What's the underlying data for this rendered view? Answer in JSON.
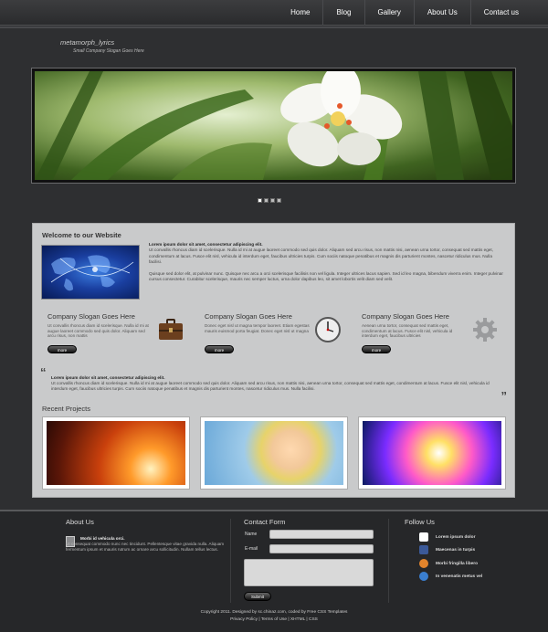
{
  "nav": {
    "items": [
      "Home",
      "Blog",
      "Gallery",
      "About Us",
      "Contact us"
    ]
  },
  "header": {
    "site_title": "metamorph_lyrics",
    "slogan": "Small Company Slogan Goes Here"
  },
  "welcome": {
    "title": "Welcome to our Website",
    "lead": "Lorem ipsum dolor sit amet, consectetur adipiscing elit.",
    "para1": "Ut convallis rhoncus diam id scelerisque. Nulla id mi at augue laoreet commodo sed quis dolor. Aliquam sed arcu risus, non mattis nisi, aenean urna tortor, consequat sed mattis eget, condimentum at lacus. Fusce elit nisl, vehicula id interdum eget, faucibus ultricies turpis. Cum sociis natoque penatibus et magnis dis parturient montes, nascetur ridiculus mus. Nulla facilisi.",
    "para2": "Quisque sed dolor elit, at pulvinar nunc. Quisque nec arcu a orci scelerisque facilisis non vel ligula. Integer ultrices lacus sapien. Sed id leo magna, bibendum viverra enim. Integer pulvinar cursus consectetur. Curabitur scelerisque, mauris nec semper luctus, urna dolor dapibus leo, sit amet lobortis velit diam sed velit."
  },
  "columns": [
    {
      "title": "Company Slogan Goes Here",
      "text": "Ut convallis rhoncus diam id scelerisque. Nulla id mi at augue laoreet commodo sed quis dolor. Aliquam sed arcu risus, non mattis",
      "more": "more",
      "icon": "briefcase-icon"
    },
    {
      "title": "Company Slogan Goes Here",
      "text": "Donec eget nisl ut magna tempor laoreet. Etiam egestas mauris euismod porta feugiat. Donec eget nisl ut magna",
      "more": "more",
      "icon": "clock-icon"
    },
    {
      "title": "Company Slogan Goes Here",
      "text": "Aenean urna tortor, consequat sed mattis eget, condimentum at lacus. Fusce elit nisl, vehicula id interdum eget, faucibus ultricies",
      "more": "more",
      "icon": "gear-icon"
    }
  ],
  "quote": {
    "lead": "Lorem ipsum dolor sit amet, consectetur adipiscing elit.",
    "text": "Ut convallis rhoncus diam id scelerisque. Nulla id mi at augue laoreet commodo sed quis dolor. Aliquam sed arcu risus, non mattis nisi, aenean urna tortor, consequat sed mattis eget, condimentum at lacus. Fusce elit nisl, vehicula id interdum eget, faucibus ultricies turpis. Cum sociis natoque penatibus et magnis dis parturient montes, nascetur ridiculus mus. Nulla facilisi."
  },
  "recent": {
    "title": "Recent Projects"
  },
  "footer": {
    "about_title": "About Us",
    "about_lead": "Morbi id vehicula orci.",
    "about_text": "Ut consequat commodo nunc nec tincidunt. Pellentesque vitae gravida nulla. Aliquam fermentum ipsum et mauris rutrum ac ornare arcu sollicitudin. Nullam tellus lectus.",
    "contact_title": "Contact Form",
    "name_label": "Name",
    "email_label": "E-mail",
    "submit_label": "Submit",
    "follow_title": "Follow Us",
    "follow_items": [
      {
        "label": "Lorem ipsum dolor",
        "icon": "twitter-icon",
        "color": "#ffffff"
      },
      {
        "label": "Maecenas in turpis",
        "icon": "facebook-icon",
        "color": "#3b5998"
      },
      {
        "label": "Morbi fringilla libero",
        "icon": "rss-icon",
        "color": "#e2842c"
      },
      {
        "label": "In venenatis metus vel",
        "icon": "delicious-icon",
        "color": "#3a7fd1"
      }
    ],
    "copyright_line1": "Copyright 2011. Designed by sc.chinaz.com, coded by Free CSS Templates",
    "copyright_line2": "Privacy Policy | Terms of Use | XHTML | CSS"
  }
}
